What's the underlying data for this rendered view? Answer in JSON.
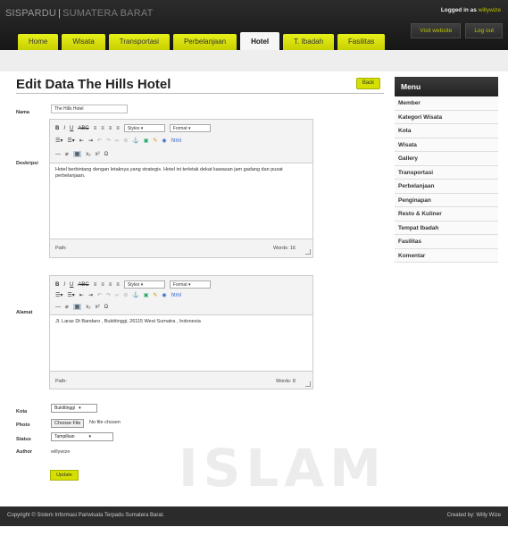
{
  "header": {
    "brand": "SISPARDU",
    "brand_sep": "|",
    "brand_sub": "SUMATERA BARAT",
    "logged_in_label": "Logged in as",
    "logged_in_user": "willywize",
    "visit_website": "Visit website",
    "log_out": "Log out"
  },
  "nav": {
    "items": [
      "Home",
      "Wisata",
      "Transportasi",
      "Perbelanjaan",
      "Hotel",
      "T. Ibadah",
      "Fasilitas"
    ],
    "active": "Hotel"
  },
  "page": {
    "title": "Edit Data The Hills Hotel",
    "back_label": "Back"
  },
  "form": {
    "nama_label": "Nama",
    "nama_value": "The Hills Hotel",
    "deskripsi_label": "Deskripsi",
    "deskripsi_text": "Hotel berbintang dengan letaknya yang strategis. Hotel ini terletak dekat kawasan jam gadang dan pusat perbelanjaan.",
    "deskripsi_path": "Path:",
    "deskripsi_words": "Words: 16",
    "alamat_label": "Alamat",
    "alamat_text": "Jl. Laras Dt Bandaro , Bukittinggi, 26115 West Sumatra , Indonesia",
    "alamat_path": "Path:",
    "alamat_words": "Words: 8",
    "kota_label": "Kota",
    "kota_value": "Bukittinggi",
    "photo_label": "Photo",
    "choose_file": "Choose File",
    "no_file": "No file chosen",
    "status_label": "Status",
    "status_value": "Tampilkan",
    "author_label": "Author",
    "author_value": "willywize",
    "update_label": "Update"
  },
  "editor_toolbar": {
    "styles": "Styles",
    "format": "Format"
  },
  "menu": {
    "title": "Menu",
    "items": [
      "Member",
      "Kategori Wisata",
      "Kota",
      "Wisata",
      "Gallery",
      "Transportasi",
      "Perbelanjaan",
      "Penginapan",
      "Resto & Kuliner",
      "Tempat Ibadah",
      "Fasilitas",
      "Komentar"
    ]
  },
  "watermark": "ISLAM",
  "footer": {
    "copyright": "Copyright © Sistem Informasi Pariwisata Terpadu Sumatera Barat.",
    "created_by": "Created by: Willy Wize"
  }
}
